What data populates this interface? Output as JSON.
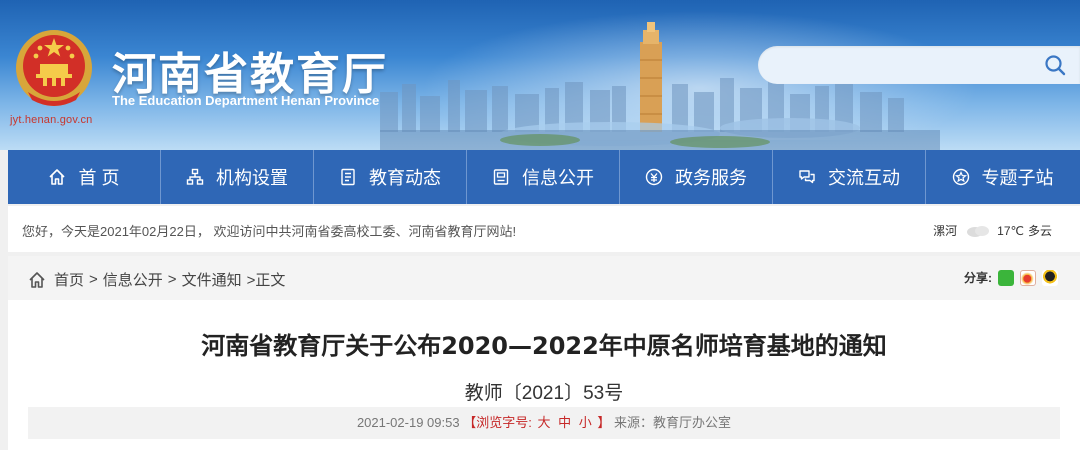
{
  "header": {
    "title": "河南省教育厅",
    "subtitle": "The Education Department Henan Province",
    "domain": "jyt.henan.gov.cn",
    "search": {
      "placeholder": ""
    }
  },
  "nav": {
    "items": [
      {
        "label": "首 页",
        "icon": "home-icon"
      },
      {
        "label": "机构设置",
        "icon": "org-icon"
      },
      {
        "label": "教育动态",
        "icon": "news-icon"
      },
      {
        "label": "信息公开",
        "icon": "info-icon"
      },
      {
        "label": "政务服务",
        "icon": "service-icon"
      },
      {
        "label": "交流互动",
        "icon": "chat-icon"
      },
      {
        "label": "专题子站",
        "icon": "topic-icon"
      }
    ]
  },
  "welcome": {
    "text": "您好，今天是2021年02月22日， 欢迎访问中共河南省委高校工委、河南省教育厅网站!",
    "city": "漯河",
    "temperature": "17℃",
    "condition": "多云"
  },
  "breadcrumb": {
    "items": [
      "首页",
      "信息公开",
      "文件通知"
    ],
    "current": ">正文",
    "separator": ">"
  },
  "share": {
    "label": "分享:"
  },
  "article": {
    "title": "河南省教育厅关于公布2020—2022年中原名师培育基地的通知",
    "doc_number": "教师〔2021〕53号",
    "date": "2021-02-19 09:53",
    "font_size_open": "【浏览字号:",
    "font_sizes": [
      "大",
      "中",
      "小"
    ],
    "font_size_close": "】",
    "source": "来源：教育厅办公室"
  },
  "colors": {
    "nav_bg": "#2f67b6",
    "accent_red": "#c62828",
    "banner_top": "#1f63b3"
  }
}
